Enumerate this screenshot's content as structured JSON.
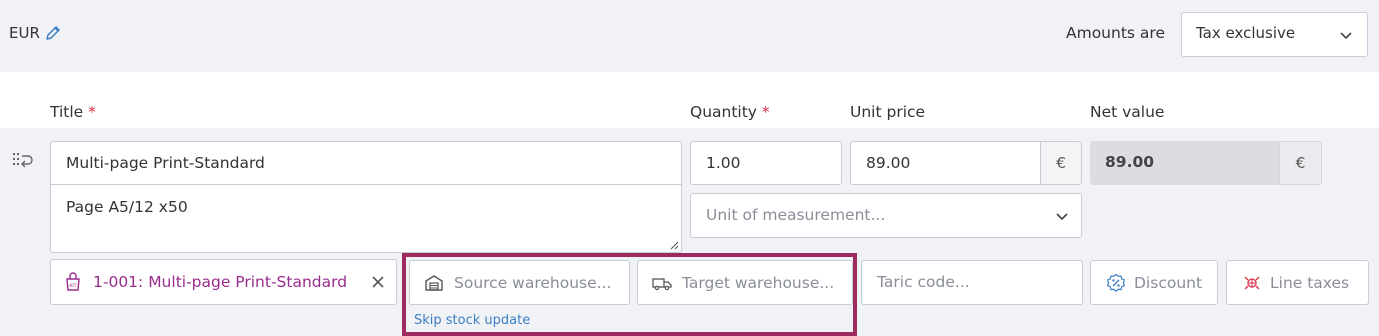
{
  "header": {
    "currency": "EUR",
    "amounts_label": "Amounts are",
    "tax_mode": "Tax exclusive"
  },
  "columns": {
    "title": "Title",
    "quantity": "Quantity",
    "unit_price": "Unit price",
    "net_value": "Net value",
    "required_mark": "*"
  },
  "line": {
    "title": "Multi-page Print-Standard",
    "description": "Page A5/12 x50",
    "quantity": "1.00",
    "unit_price": "89.00",
    "currency_symbol": "€",
    "net_value": "89.00",
    "uom_placeholder": "Unit of measurement...",
    "product": "1-001: Multi-page Print-Standard",
    "source_warehouse_placeholder": "Source warehouse...",
    "target_warehouse_placeholder": "Target warehouse...",
    "taric_placeholder": "Taric code...",
    "discount_label": "Discount",
    "line_taxes_label": "Line taxes",
    "skip_stock_update": "Skip stock update"
  },
  "colors": {
    "accent_link": "#3a7fc4",
    "product_tag": "#9a2c8e",
    "required": "#d9304a",
    "highlight": "#9e2b5f"
  }
}
